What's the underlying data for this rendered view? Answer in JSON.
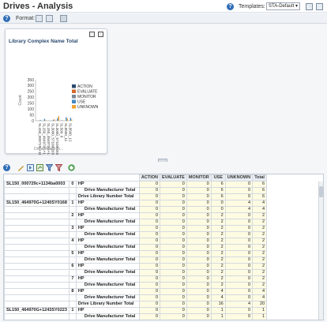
{
  "header": {
    "title": "Drives - Analysis",
    "templates_label": "Templates:",
    "template_value": "STA-Default",
    "help": "?"
  },
  "subbar": {
    "format_label": "Format:",
    "help": "?"
  },
  "chart_panel": {
    "chart_data": {
      "type": "bar",
      "title": "Library Complex Name Total",
      "xlabel": "Drive Health In...",
      "ylabel": "Count",
      "ylim": [
        0,
        350
      ],
      "yticks": [
        "350",
        "300",
        "250",
        "200",
        "150",
        "100",
        "50",
        "0"
      ],
      "categories": [
        "SL150_000729c+1134ba0003",
        "SL150_464970G+1240SY0168",
        "SL150_464970G+1243SY0223",
        "SL3000_571000200341",
        "SL3000_571000200342",
        "SL500_8",
        "SL8500_11",
        "SL8500_12"
      ],
      "series": [
        {
          "name": "ACTION",
          "color": "#2b4a6f",
          "values": [
            0,
            0,
            0,
            0,
            0,
            0,
            0,
            0
          ]
        },
        {
          "name": "EVALUATE",
          "color": "#d86a2a",
          "values": [
            0,
            0,
            0,
            0,
            0,
            0,
            0,
            0
          ]
        },
        {
          "name": "MONITOR",
          "color": "#7b8894",
          "values": [
            0,
            0,
            0,
            0,
            0,
            0,
            0,
            0
          ]
        },
        {
          "name": "USE",
          "color": "#3f88c5",
          "values": [
            6,
            16,
            1,
            8,
            22,
            4,
            30,
            25
          ]
        },
        {
          "name": "UNKNOWN",
          "color": "#f0a336",
          "values": [
            0,
            4,
            0,
            12,
            40,
            0,
            18,
            10
          ]
        }
      ]
    }
  },
  "table": {
    "headers": [
      "ACTION",
      "EVALUATE",
      "MONITOR",
      "USE",
      "UNKNOWN",
      "Total"
    ],
    "rows": [
      {
        "lib": "SL150_000729c+1134ba0003",
        "drive": "0",
        "mfr": "HP",
        "total": false,
        "v": [
          "0",
          "0",
          "0",
          "6",
          "0",
          "6"
        ]
      },
      {
        "lib": "",
        "drive": "",
        "mfr": "Drive Manufacturer Total",
        "total": true,
        "v": [
          "0",
          "0",
          "0",
          "6",
          "0",
          "6"
        ]
      },
      {
        "lib": "",
        "drive": "",
        "mfr": "Drive Library Number Total",
        "total": true,
        "libtotal": true,
        "v": [
          "0",
          "0",
          "0",
          "6",
          "0",
          "6"
        ]
      },
      {
        "lib": "SL150_464970G+1240SY0168",
        "drive": "1",
        "mfr": "HP",
        "total": false,
        "v": [
          "0",
          "0",
          "0",
          "0",
          "4",
          "4"
        ]
      },
      {
        "lib": "",
        "drive": "",
        "mfr": "Drive Manufacturer Total",
        "total": true,
        "v": [
          "0",
          "0",
          "0",
          "0",
          "4",
          "4"
        ]
      },
      {
        "lib": "",
        "drive": "2",
        "mfr": "HP",
        "total": false,
        "v": [
          "0",
          "0",
          "0",
          "2",
          "0",
          "2"
        ]
      },
      {
        "lib": "",
        "drive": "",
        "mfr": "Drive Manufacturer Total",
        "total": true,
        "v": [
          "0",
          "0",
          "0",
          "2",
          "0",
          "2"
        ]
      },
      {
        "lib": "",
        "drive": "3",
        "mfr": "HP",
        "total": false,
        "v": [
          "0",
          "0",
          "0",
          "2",
          "0",
          "2"
        ]
      },
      {
        "lib": "",
        "drive": "",
        "mfr": "Drive Manufacturer Total",
        "total": true,
        "v": [
          "0",
          "0",
          "0",
          "2",
          "0",
          "2"
        ]
      },
      {
        "lib": "",
        "drive": "4",
        "mfr": "HP",
        "total": false,
        "v": [
          "0",
          "0",
          "0",
          "2",
          "0",
          "2"
        ]
      },
      {
        "lib": "",
        "drive": "",
        "mfr": "Drive Manufacturer Total",
        "total": true,
        "v": [
          "0",
          "0",
          "0",
          "2",
          "0",
          "2"
        ]
      },
      {
        "lib": "",
        "drive": "5",
        "mfr": "HP",
        "total": false,
        "v": [
          "0",
          "0",
          "0",
          "2",
          "0",
          "2"
        ]
      },
      {
        "lib": "",
        "drive": "",
        "mfr": "Drive Manufacturer Total",
        "total": true,
        "v": [
          "0",
          "0",
          "0",
          "2",
          "0",
          "2"
        ]
      },
      {
        "lib": "",
        "drive": "6",
        "mfr": "HP",
        "total": false,
        "v": [
          "0",
          "0",
          "0",
          "2",
          "0",
          "2"
        ]
      },
      {
        "lib": "",
        "drive": "",
        "mfr": "Drive Manufacturer Total",
        "total": true,
        "v": [
          "0",
          "0",
          "0",
          "2",
          "0",
          "2"
        ]
      },
      {
        "lib": "",
        "drive": "7",
        "mfr": "HP",
        "total": false,
        "v": [
          "0",
          "0",
          "0",
          "2",
          "0",
          "2"
        ]
      },
      {
        "lib": "",
        "drive": "",
        "mfr": "Drive Manufacturer Total",
        "total": true,
        "v": [
          "0",
          "0",
          "0",
          "2",
          "0",
          "2"
        ]
      },
      {
        "lib": "",
        "drive": "8",
        "mfr": "HP",
        "total": false,
        "v": [
          "0",
          "0",
          "0",
          "4",
          "0",
          "4"
        ]
      },
      {
        "lib": "",
        "drive": "",
        "mfr": "Drive Manufacturer Total",
        "total": true,
        "v": [
          "0",
          "0",
          "0",
          "4",
          "0",
          "4"
        ]
      },
      {
        "lib": "",
        "drive": "",
        "mfr": "Drive Library Number Total",
        "total": true,
        "libtotal": true,
        "v": [
          "0",
          "0",
          "0",
          "16",
          "4",
          "20"
        ]
      },
      {
        "lib": "SL150_464970G+1243SY0223",
        "drive": "1",
        "mfr": "HP",
        "total": false,
        "v": [
          "0",
          "0",
          "0",
          "1",
          "0",
          "1"
        ]
      },
      {
        "lib": "",
        "drive": "",
        "mfr": "Drive Manufacturer Total",
        "total": true,
        "v": [
          "0",
          "0",
          "0",
          "1",
          "0",
          "1"
        ]
      }
    ]
  }
}
